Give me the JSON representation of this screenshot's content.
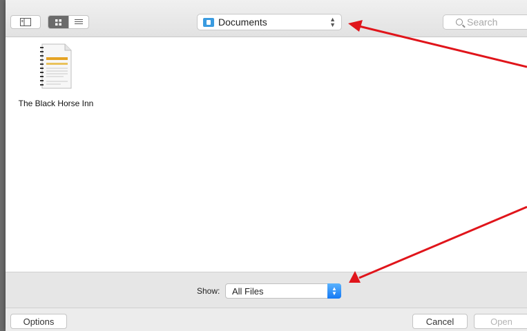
{
  "location": {
    "label": "Documents",
    "icon": "folder-icon",
    "icon_color": "#3a9be0"
  },
  "search": {
    "placeholder": "Search"
  },
  "view_buttons": {
    "icon_view": "grid-icon",
    "list_view": "list-icon",
    "sidebar_toggle": "sidebar-icon"
  },
  "files": [
    {
      "name": "The Black Horse Inn"
    }
  ],
  "show": {
    "label": "Show:",
    "selected": "All Files"
  },
  "buttons": {
    "options": "Options",
    "cancel": "Cancel",
    "open": "Open"
  },
  "annotation": {
    "arrow_color": "#e0151b"
  }
}
